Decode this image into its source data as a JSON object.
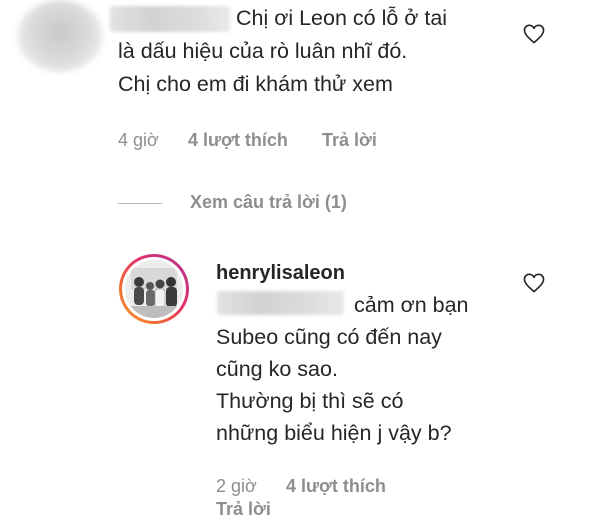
{
  "comment": {
    "line1": "Chị ơi Leon có lỗ ở tai",
    "line2": "là dấu hiệu của rò luân nhĩ đó.",
    "line3": "Chị cho em đi khám thử xem",
    "time": "4 giờ",
    "likes": "4 lượt thích",
    "reply": "Trả lời"
  },
  "view_replies": "Xem câu trả lời (1)",
  "reply_comment": {
    "username": "henrylisaleon",
    "line1": "cảm ơn bạn",
    "line2": "Subeo cũng có đến nay",
    "line3": "cũng ko sao.",
    "line4": "Thường bị thì sẽ có",
    "line5": "những biểu hiện j vậy b?",
    "time": "2 giờ",
    "likes": "4 lượt thích",
    "reply": "Trả lời"
  },
  "icons": {
    "like": "heart-outline-icon"
  },
  "colors": {
    "text": "#262626",
    "meta": "#8e8e8e",
    "ring_start": "#f9a23c",
    "ring_end": "#a83caf"
  }
}
